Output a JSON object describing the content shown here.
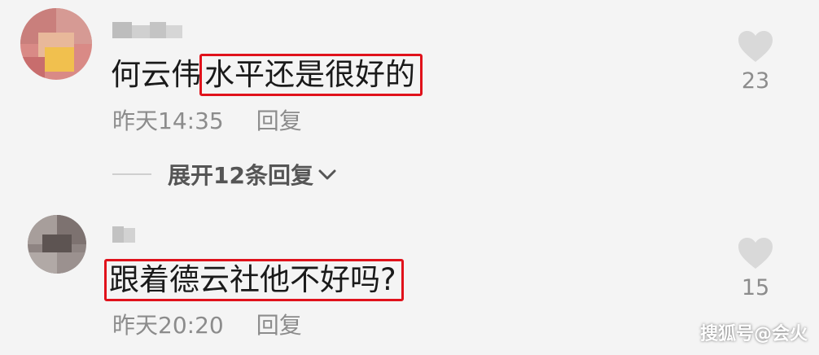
{
  "comments": [
    {
      "content_plain": "何云伟",
      "content_boxed": "水平还是很好的",
      "time": "昨天14:35",
      "reply_label": "回复",
      "likes": "23"
    },
    {
      "content_plain": "",
      "content_boxed": "跟着德云社他不好吗?",
      "time": "昨天20:20",
      "reply_label": "回复",
      "likes": "15"
    }
  ],
  "expand_replies_label": "展开12条回复",
  "watermark": "搜狐号@会火",
  "colors": {
    "highlight_border": "#e0121b",
    "meta_text": "#8c8c8c",
    "heart": "#d9d9d9",
    "background": "#f4f4f4"
  },
  "icons": {
    "like": "heart-icon",
    "expand": "chevron-down-icon"
  }
}
